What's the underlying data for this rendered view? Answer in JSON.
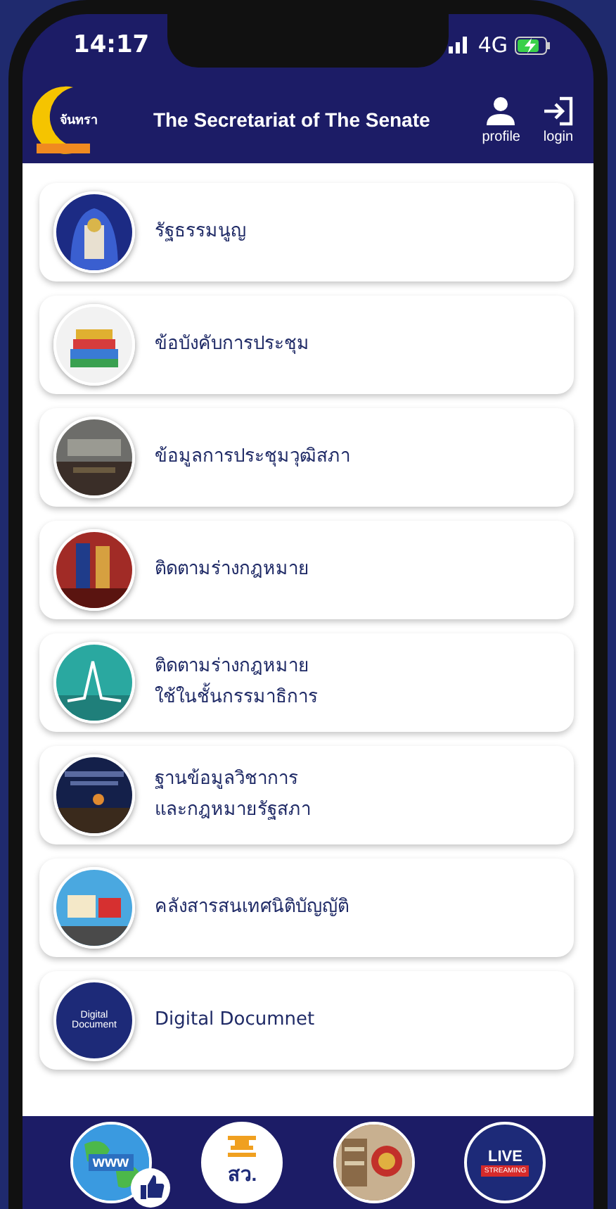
{
  "status_bar": {
    "time": "14:17",
    "network": "4G"
  },
  "header": {
    "logo_text": "จันทรา",
    "title": "The Secretariat of The Senate",
    "actions": [
      {
        "label": "profile",
        "kind": "profile"
      },
      {
        "label": "login",
        "kind": "login"
      }
    ]
  },
  "menu": [
    {
      "label": "รัฐธรรมนูญ"
    },
    {
      "label": "ข้อบังคับการประชุม"
    },
    {
      "label": "ข้อมูลการประชุมวุฒิสภา"
    },
    {
      "label": "ติดตามร่างกฎหมาย"
    },
    {
      "label": "ติดตามร่างกฎหมาย\nใช้ในชั้นกรรมาธิการ"
    },
    {
      "label": "ฐานข้อมูลวิชาการ\nและกฎหมายรัฐสภา"
    },
    {
      "label": "คลังสารสนเทศนิติบัญญัติ"
    },
    {
      "label": "Digital Documnet",
      "badge": "Digital Document"
    }
  ],
  "footer": [
    {
      "kind": "web",
      "label": "www"
    },
    {
      "kind": "senate",
      "label": "สว."
    },
    {
      "kind": "library"
    },
    {
      "kind": "live",
      "label": "LIVE",
      "sublabel": "STREAMING"
    }
  ]
}
